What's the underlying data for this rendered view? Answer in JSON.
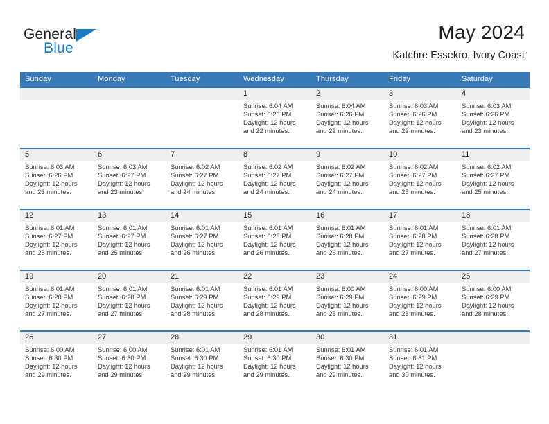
{
  "brand": {
    "name_part1": "General",
    "name_part2": "Blue",
    "accent_color": "#1a7ac0"
  },
  "header": {
    "title": "May 2024",
    "subtitle": "Katchre Essekro, Ivory Coast"
  },
  "theme": {
    "header_blue": "#3a79b8",
    "daynum_band": "#efefef",
    "text": "#231f20"
  },
  "weekdays": [
    "Sunday",
    "Monday",
    "Tuesday",
    "Wednesday",
    "Thursday",
    "Friday",
    "Saturday"
  ],
  "weeks": [
    [
      {
        "day": "",
        "sunrise": "",
        "sunset": "",
        "daylight1": "",
        "daylight2": ""
      },
      {
        "day": "",
        "sunrise": "",
        "sunset": "",
        "daylight1": "",
        "daylight2": ""
      },
      {
        "day": "",
        "sunrise": "",
        "sunset": "",
        "daylight1": "",
        "daylight2": ""
      },
      {
        "day": "1",
        "sunrise": "Sunrise: 6:04 AM",
        "sunset": "Sunset: 6:26 PM",
        "daylight1": "Daylight: 12 hours",
        "daylight2": "and 22 minutes."
      },
      {
        "day": "2",
        "sunrise": "Sunrise: 6:04 AM",
        "sunset": "Sunset: 6:26 PM",
        "daylight1": "Daylight: 12 hours",
        "daylight2": "and 22 minutes."
      },
      {
        "day": "3",
        "sunrise": "Sunrise: 6:03 AM",
        "sunset": "Sunset: 6:26 PM",
        "daylight1": "Daylight: 12 hours",
        "daylight2": "and 22 minutes."
      },
      {
        "day": "4",
        "sunrise": "Sunrise: 6:03 AM",
        "sunset": "Sunset: 6:26 PM",
        "daylight1": "Daylight: 12 hours",
        "daylight2": "and 23 minutes."
      }
    ],
    [
      {
        "day": "5",
        "sunrise": "Sunrise: 6:03 AM",
        "sunset": "Sunset: 6:26 PM",
        "daylight1": "Daylight: 12 hours",
        "daylight2": "and 23 minutes."
      },
      {
        "day": "6",
        "sunrise": "Sunrise: 6:03 AM",
        "sunset": "Sunset: 6:27 PM",
        "daylight1": "Daylight: 12 hours",
        "daylight2": "and 23 minutes."
      },
      {
        "day": "7",
        "sunrise": "Sunrise: 6:02 AM",
        "sunset": "Sunset: 6:27 PM",
        "daylight1": "Daylight: 12 hours",
        "daylight2": "and 24 minutes."
      },
      {
        "day": "8",
        "sunrise": "Sunrise: 6:02 AM",
        "sunset": "Sunset: 6:27 PM",
        "daylight1": "Daylight: 12 hours",
        "daylight2": "and 24 minutes."
      },
      {
        "day": "9",
        "sunrise": "Sunrise: 6:02 AM",
        "sunset": "Sunset: 6:27 PM",
        "daylight1": "Daylight: 12 hours",
        "daylight2": "and 24 minutes."
      },
      {
        "day": "10",
        "sunrise": "Sunrise: 6:02 AM",
        "sunset": "Sunset: 6:27 PM",
        "daylight1": "Daylight: 12 hours",
        "daylight2": "and 25 minutes."
      },
      {
        "day": "11",
        "sunrise": "Sunrise: 6:02 AM",
        "sunset": "Sunset: 6:27 PM",
        "daylight1": "Daylight: 12 hours",
        "daylight2": "and 25 minutes."
      }
    ],
    [
      {
        "day": "12",
        "sunrise": "Sunrise: 6:01 AM",
        "sunset": "Sunset: 6:27 PM",
        "daylight1": "Daylight: 12 hours",
        "daylight2": "and 25 minutes."
      },
      {
        "day": "13",
        "sunrise": "Sunrise: 6:01 AM",
        "sunset": "Sunset: 6:27 PM",
        "daylight1": "Daylight: 12 hours",
        "daylight2": "and 25 minutes."
      },
      {
        "day": "14",
        "sunrise": "Sunrise: 6:01 AM",
        "sunset": "Sunset: 6:27 PM",
        "daylight1": "Daylight: 12 hours",
        "daylight2": "and 26 minutes."
      },
      {
        "day": "15",
        "sunrise": "Sunrise: 6:01 AM",
        "sunset": "Sunset: 6:28 PM",
        "daylight1": "Daylight: 12 hours",
        "daylight2": "and 26 minutes."
      },
      {
        "day": "16",
        "sunrise": "Sunrise: 6:01 AM",
        "sunset": "Sunset: 6:28 PM",
        "daylight1": "Daylight: 12 hours",
        "daylight2": "and 26 minutes."
      },
      {
        "day": "17",
        "sunrise": "Sunrise: 6:01 AM",
        "sunset": "Sunset: 6:28 PM",
        "daylight1": "Daylight: 12 hours",
        "daylight2": "and 27 minutes."
      },
      {
        "day": "18",
        "sunrise": "Sunrise: 6:01 AM",
        "sunset": "Sunset: 6:28 PM",
        "daylight1": "Daylight: 12 hours",
        "daylight2": "and 27 minutes."
      }
    ],
    [
      {
        "day": "19",
        "sunrise": "Sunrise: 6:01 AM",
        "sunset": "Sunset: 6:28 PM",
        "daylight1": "Daylight: 12 hours",
        "daylight2": "and 27 minutes."
      },
      {
        "day": "20",
        "sunrise": "Sunrise: 6:01 AM",
        "sunset": "Sunset: 6:28 PM",
        "daylight1": "Daylight: 12 hours",
        "daylight2": "and 27 minutes."
      },
      {
        "day": "21",
        "sunrise": "Sunrise: 6:01 AM",
        "sunset": "Sunset: 6:29 PM",
        "daylight1": "Daylight: 12 hours",
        "daylight2": "and 28 minutes."
      },
      {
        "day": "22",
        "sunrise": "Sunrise: 6:01 AM",
        "sunset": "Sunset: 6:29 PM",
        "daylight1": "Daylight: 12 hours",
        "daylight2": "and 28 minutes."
      },
      {
        "day": "23",
        "sunrise": "Sunrise: 6:00 AM",
        "sunset": "Sunset: 6:29 PM",
        "daylight1": "Daylight: 12 hours",
        "daylight2": "and 28 minutes."
      },
      {
        "day": "24",
        "sunrise": "Sunrise: 6:00 AM",
        "sunset": "Sunset: 6:29 PM",
        "daylight1": "Daylight: 12 hours",
        "daylight2": "and 28 minutes."
      },
      {
        "day": "25",
        "sunrise": "Sunrise: 6:00 AM",
        "sunset": "Sunset: 6:29 PM",
        "daylight1": "Daylight: 12 hours",
        "daylight2": "and 28 minutes."
      }
    ],
    [
      {
        "day": "26",
        "sunrise": "Sunrise: 6:00 AM",
        "sunset": "Sunset: 6:30 PM",
        "daylight1": "Daylight: 12 hours",
        "daylight2": "and 29 minutes."
      },
      {
        "day": "27",
        "sunrise": "Sunrise: 6:00 AM",
        "sunset": "Sunset: 6:30 PM",
        "daylight1": "Daylight: 12 hours",
        "daylight2": "and 29 minutes."
      },
      {
        "day": "28",
        "sunrise": "Sunrise: 6:01 AM",
        "sunset": "Sunset: 6:30 PM",
        "daylight1": "Daylight: 12 hours",
        "daylight2": "and 29 minutes."
      },
      {
        "day": "29",
        "sunrise": "Sunrise: 6:01 AM",
        "sunset": "Sunset: 6:30 PM",
        "daylight1": "Daylight: 12 hours",
        "daylight2": "and 29 minutes."
      },
      {
        "day": "30",
        "sunrise": "Sunrise: 6:01 AM",
        "sunset": "Sunset: 6:30 PM",
        "daylight1": "Daylight: 12 hours",
        "daylight2": "and 29 minutes."
      },
      {
        "day": "31",
        "sunrise": "Sunrise: 6:01 AM",
        "sunset": "Sunset: 6:31 PM",
        "daylight1": "Daylight: 12 hours",
        "daylight2": "and 30 minutes."
      },
      {
        "day": "",
        "sunrise": "",
        "sunset": "",
        "daylight1": "",
        "daylight2": ""
      }
    ]
  ]
}
